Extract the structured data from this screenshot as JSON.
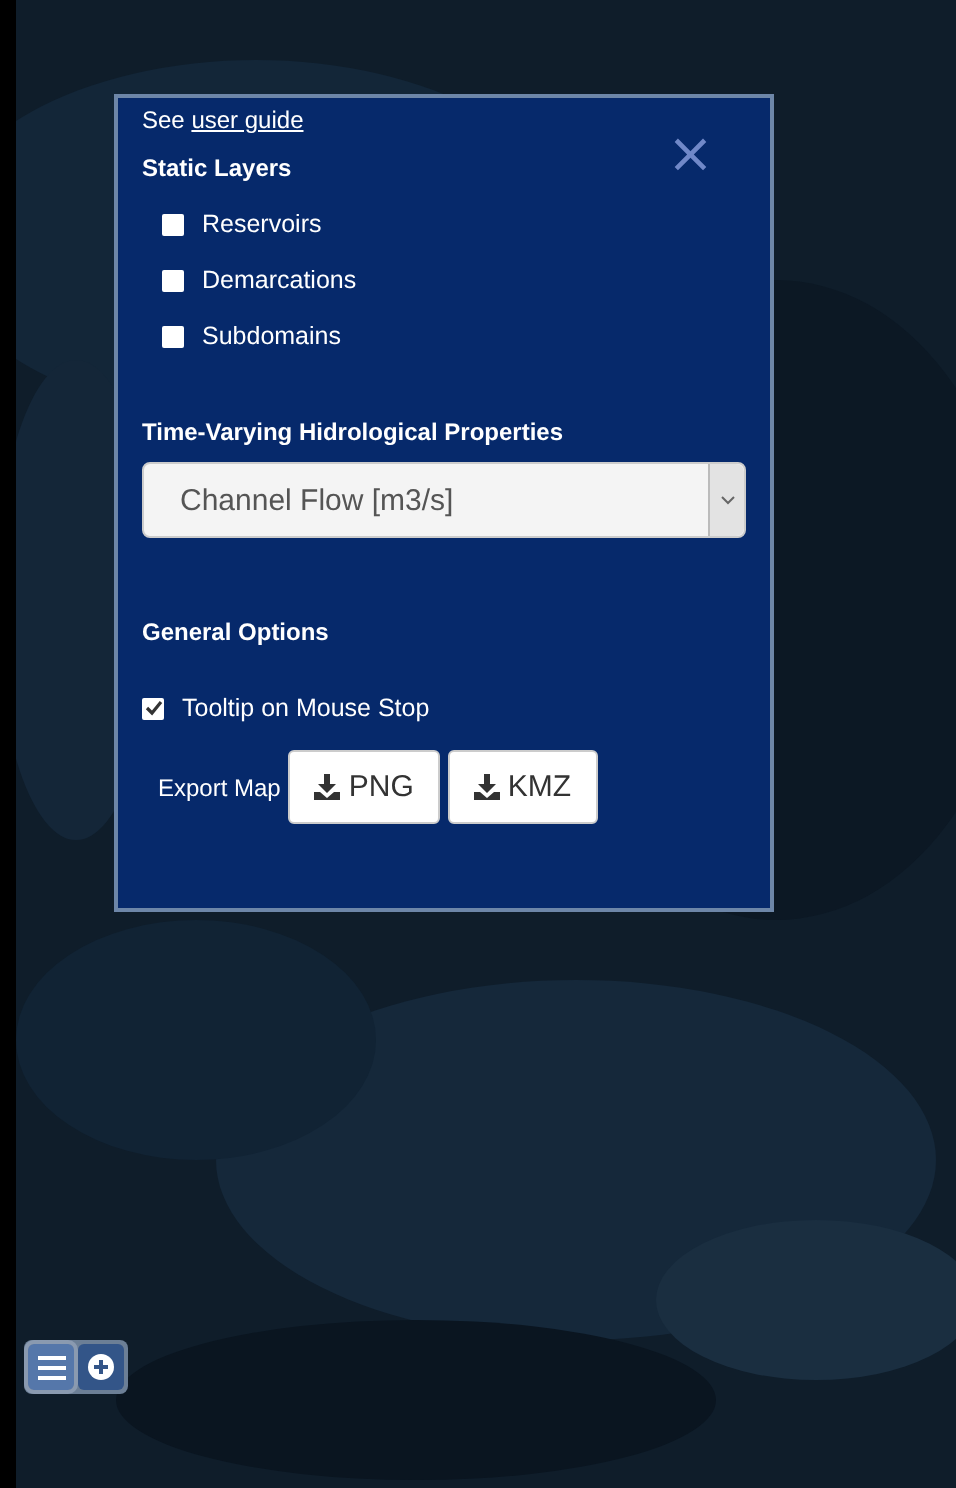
{
  "panel": {
    "guide_prefix": "See",
    "guide_link": "user guide",
    "close": "×",
    "static_layers": {
      "title": "Static Layers",
      "items": [
        {
          "label": "Reservoirs",
          "checked": false
        },
        {
          "label": "Demarcations",
          "checked": false
        },
        {
          "label": "Subdomains",
          "checked": false
        }
      ]
    },
    "time_varying": {
      "title": "Time-Varying Hidrological Properties",
      "value": "Channel Flow [m3/s]"
    },
    "general": {
      "title": "General Options",
      "tooltip": {
        "label": "Tooltip on Mouse Stop",
        "checked": true
      },
      "export_label": "Export Map",
      "export_buttons": [
        "PNG",
        "KMZ"
      ]
    }
  },
  "map_controls": [
    {
      "kind": "layers",
      "selected": true
    },
    {
      "kind": "add",
      "selected": false
    }
  ]
}
